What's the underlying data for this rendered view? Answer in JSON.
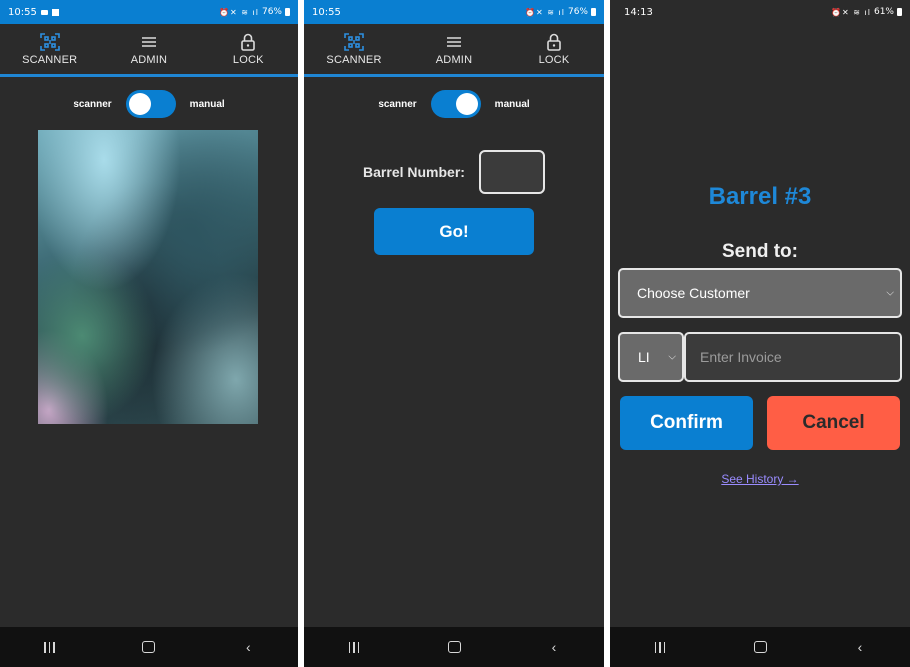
{
  "screens": [
    {
      "status": {
        "time": "10:55",
        "battery": "76%"
      },
      "nav": [
        {
          "label": "SCANNER",
          "icon": "qr-scan-icon"
        },
        {
          "label": "ADMIN",
          "icon": "hamburger-icon"
        },
        {
          "label": "LOCK",
          "icon": "lock-icon"
        }
      ],
      "toggle": {
        "left_label": "scanner",
        "right_label": "manual",
        "state": "scanner"
      }
    },
    {
      "status": {
        "time": "10:55",
        "battery": "76%"
      },
      "nav": [
        {
          "label": "SCANNER",
          "icon": "qr-scan-icon"
        },
        {
          "label": "ADMIN",
          "icon": "hamburger-icon"
        },
        {
          "label": "LOCK",
          "icon": "lock-icon"
        }
      ],
      "toggle": {
        "left_label": "scanner",
        "right_label": "manual",
        "state": "manual"
      },
      "barrel_label": "Barrel Number:",
      "barrel_value": "",
      "go_label": "Go!"
    },
    {
      "status": {
        "time": "14:13",
        "battery": "61%"
      },
      "barrel_title": "Barrel #3",
      "send_to": "Send to:",
      "customer_select": "Choose Customer",
      "prefix_select": "LI",
      "invoice_placeholder": "Enter Invoice",
      "confirm_label": "Confirm",
      "cancel_label": "Cancel",
      "history_link": "See History →"
    }
  ],
  "colors": {
    "accent": "#0a7fd1",
    "cancel": "#ff5e45",
    "background": "#2b2b2b",
    "link": "#9a8cff"
  }
}
